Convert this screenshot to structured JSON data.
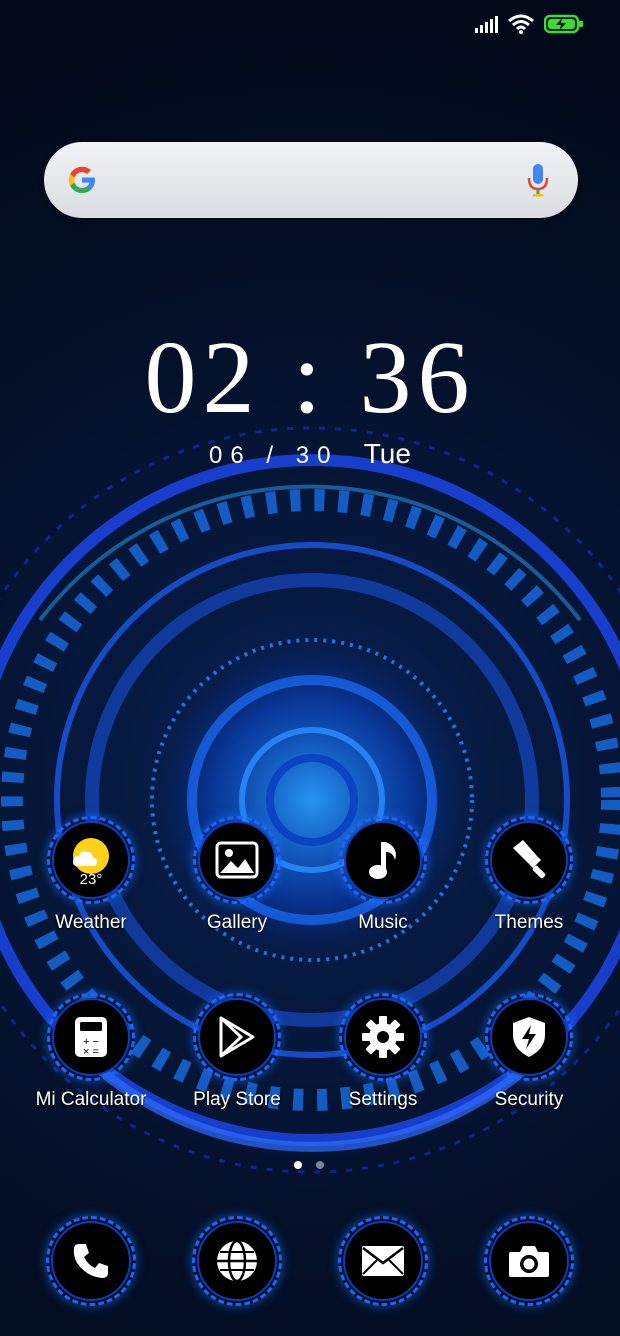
{
  "status_bar": {
    "battery_state": "charging"
  },
  "search_bar": {
    "logo": "google-g-icon",
    "mic": "mic-icon"
  },
  "clock": {
    "time": "02 : 36",
    "date": "06 / 30",
    "day": "Tue"
  },
  "apps": [
    {
      "label": "Weather",
      "icon": "weather-icon",
      "temp": "23°"
    },
    {
      "label": "Gallery",
      "icon": "gallery-icon"
    },
    {
      "label": "Music",
      "icon": "music-note-icon"
    },
    {
      "label": "Themes",
      "icon": "paint-brush-icon"
    },
    {
      "label": "Mi Calculator",
      "icon": "calculator-icon"
    },
    {
      "label": "Play Store",
      "icon": "play-store-icon"
    },
    {
      "label": "Settings",
      "icon": "gear-icon"
    },
    {
      "label": "Security",
      "icon": "shield-bolt-icon"
    }
  ],
  "page_indicator": {
    "pages": 2,
    "current": 1
  },
  "dock": [
    {
      "icon": "phone-icon"
    },
    {
      "icon": "browser-globe-icon"
    },
    {
      "icon": "messages-envelope-icon"
    },
    {
      "icon": "camera-icon"
    }
  ],
  "colors": {
    "accent": "#1d63ff",
    "charging": "#3ddc2f",
    "weather_sun": "#ffd21a"
  }
}
